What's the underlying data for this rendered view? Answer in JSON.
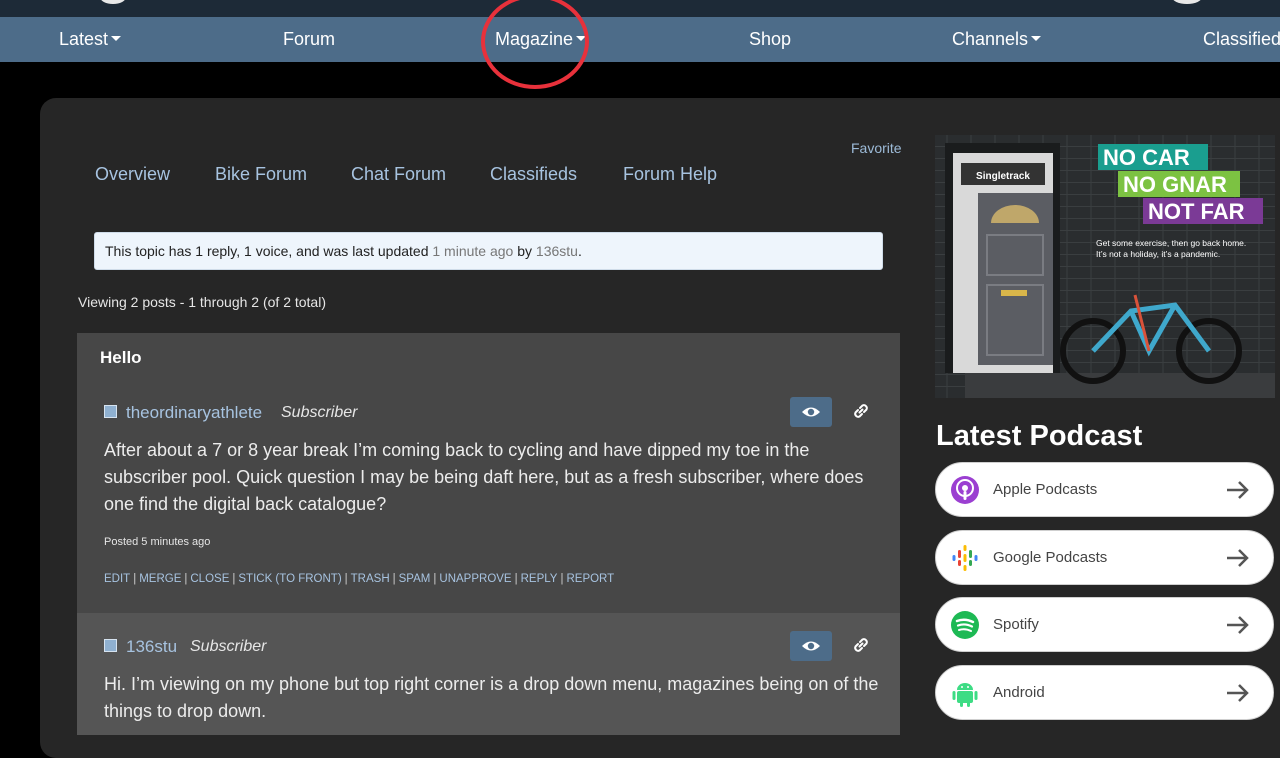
{
  "nav": {
    "items": [
      {
        "label": "Latest",
        "caret": true
      },
      {
        "label": "Forum",
        "caret": false
      },
      {
        "label": "Magazine",
        "caret": true
      },
      {
        "label": "Shop",
        "caret": false
      },
      {
        "label": "Channels",
        "caret": true
      },
      {
        "label": "Classifieds",
        "caret": false
      }
    ]
  },
  "favorite_label": "Favorite",
  "subnav": [
    "Overview",
    "Bike Forum",
    "Chat Forum",
    "Classifieds",
    "Forum Help"
  ],
  "notice": {
    "prefix": "This topic has 1 reply, 1 voice, and was last updated ",
    "time": "1 minute ago",
    "by": " by ",
    "user": "136stu",
    "suffix": "."
  },
  "viewing": "Viewing 2 posts - 1 through 2 (of 2 total)",
  "topic_title": "Hello",
  "posts": [
    {
      "user": "theordinaryathlete",
      "role": "Subscriber",
      "text": "After about a 7 or 8 year break I’m coming back to cycling and have dipped my toe in the subscriber pool. Quick question I may be being daft here, but as a fresh subscriber, where does one find the digital back catalogue?",
      "posted": "Posted 5 minutes ago",
      "actions": [
        "EDIT",
        "MERGE",
        "CLOSE",
        "STICK (TO FRONT)",
        "TRASH",
        "SPAM",
        "UNAPPROVE",
        "REPLY",
        "REPORT"
      ]
    },
    {
      "user": "136stu",
      "role": "Subscriber",
      "text": "Hi. I’m viewing on my phone but top right corner is a drop down menu, magazines being on of the things to drop down."
    }
  ],
  "ad": {
    "door_sign": "Singletrack",
    "line1": "NO CAR",
    "line2": "NO GNAR",
    "line3": "NOT FAR",
    "body1": "Get some exercise, then go back home.",
    "body2": "It’s not a holiday, it’s a pandemic.",
    "colors": {
      "line1": "#1a9e8f",
      "line2": "#7cc242",
      "line3": "#7b3a96"
    }
  },
  "podcast": {
    "heading": "Latest Podcast",
    "links": [
      {
        "label": "Apple Podcasts",
        "icon": "apple-podcasts-icon"
      },
      {
        "label": "Google Podcasts",
        "icon": "google-podcasts-icon"
      },
      {
        "label": "Spotify",
        "icon": "spotify-icon"
      },
      {
        "label": "Android",
        "icon": "android-icon"
      }
    ]
  },
  "colors": {
    "nav_bg": "#4d6c89",
    "link": "#a7c3e0",
    "highlight_circle": "#e8313b"
  }
}
